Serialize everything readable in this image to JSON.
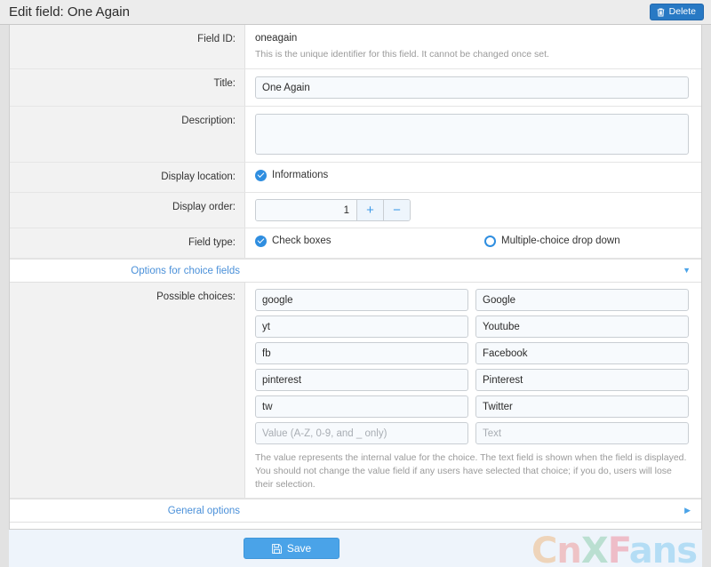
{
  "header": {
    "title": "Edit field: One Again",
    "delete_label": "Delete",
    "delete_icon": "trash-icon"
  },
  "form": {
    "field_id": {
      "label": "Field ID:",
      "value": "oneagain",
      "help": "This is the unique identifier for this field. It cannot be changed once set."
    },
    "title": {
      "label": "Title:",
      "value": "One Again",
      "placeholder": ""
    },
    "description": {
      "label": "Description:",
      "value": "",
      "placeholder": ""
    },
    "display_location": {
      "label": "Display location:",
      "options": [
        {
          "label": "Informations",
          "checked": true
        }
      ]
    },
    "display_order": {
      "label": "Display order:",
      "value": "1",
      "increment_label": "+",
      "decrement_label": "−"
    },
    "field_type": {
      "label": "Field type:",
      "options": [
        {
          "label": "Check boxes",
          "checked": true
        },
        {
          "label": "Multiple-choice drop down",
          "checked": false
        }
      ]
    }
  },
  "sections": {
    "choice_options": {
      "title": "Options for choice fields",
      "caret": "▼",
      "expanded": true
    },
    "general_options": {
      "title": "General options",
      "caret": "▶",
      "expanded": false
    }
  },
  "choices": {
    "label": "Possible choices:",
    "value_placeholder": "Value (A-Z, 0-9, and _ only)",
    "text_placeholder": "Text",
    "rows": [
      {
        "value": "google",
        "text": "Google"
      },
      {
        "value": "yt",
        "text": "Youtube"
      },
      {
        "value": "fb",
        "text": "Facebook"
      },
      {
        "value": "pinterest",
        "text": "Pinterest"
      },
      {
        "value": "tw",
        "text": "Twitter"
      },
      {
        "value": "",
        "text": ""
      }
    ],
    "help": "The value represents the internal value for the choice. The text field is shown when the field is displayed. You should not change the value field if any users have selected that choice; if you do, users will lose their selection."
  },
  "footer": {
    "save_label": "Save",
    "save_icon": "floppy-save-icon"
  },
  "watermark": {
    "letters": [
      "C",
      "n",
      "X",
      "F",
      "a",
      "n",
      "s"
    ],
    "text": "CnXFans"
  },
  "colors": {
    "accent": "#4aa3e8",
    "delete_button": "#2879c4",
    "link": "#4a90d9",
    "input_bg": "#f7fafd",
    "label_bg": "#f2f2f2",
    "footer_bg": "#eef4fb"
  }
}
